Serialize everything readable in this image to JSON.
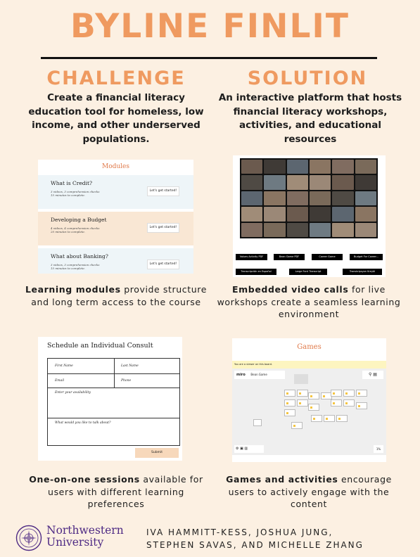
{
  "title": "BYLINE FINLIT",
  "challenge": {
    "heading": "CHALLENGE",
    "text": "Create a financial literacy education tool for homeless, low income, and other underserved populations."
  },
  "solution": {
    "heading": "SOLUTION",
    "text": "An interactive platform that hosts financial literacy workshops, activities, and educational resources"
  },
  "modules_panel": {
    "title": "Modules",
    "items": [
      {
        "name": "What is Credit?",
        "desc1": "3 videos, 3 comprehension checks",
        "desc2": "15 minutes to complete.",
        "button": "Let's get started!",
        "bg": "#eef5f8"
      },
      {
        "name": "Developing a Budget",
        "desc1": "4 videos, 4 comprehension checks",
        "desc2": "20 minutes to complete.",
        "button": "Let's get started!",
        "bg": "#f9e7d4"
      },
      {
        "name": "What about Banking?",
        "desc1": "3 videos, 3 comprehension checks",
        "desc2": "15 minutes to complete.",
        "button": "Let's get started!",
        "bg": "#eef5f8"
      }
    ]
  },
  "video_panel": {
    "buttons": [
      "Values Activity PDF",
      "Bean Game PDF",
      "Career Game",
      "Budget For Career...",
      "Transcripción en Español",
      "Large Font Transcript",
      "Transkripsyon Kreyòl"
    ]
  },
  "consult_panel": {
    "title": "Schedule an Individual Consult",
    "first_name": "First Name",
    "last_name": "Last Name",
    "email": "Email",
    "phone": "Phone",
    "availability": "Enter your availability",
    "talk_about": "What would you like to talk about?",
    "submit": "Submit"
  },
  "games_panel": {
    "title": "Games",
    "bar_text": "You are a viewer on this board.",
    "app_name": "miro",
    "board_name": "Bean Game",
    "zoom": "1%"
  },
  "captions": {
    "modules_bold": "Learning modules",
    "modules_rest": " provide structure and long term access to the course",
    "video_bold": "Embedded video calls",
    "video_rest": " for live workshops create a seamless learning environment",
    "consult_bold": "One-on-one sessions",
    "consult_rest": " available for users with different learning preferences",
    "games_bold": "Games and activities",
    "games_rest": " encourage users to actively engage with the content"
  },
  "footer": {
    "university_line1": "Northwestern",
    "university_line2": "University",
    "authors_line1": "IVA HAMMITT-KESS, JOSHUA JUNG,",
    "authors_line2": "STEPHEN SAVAS, AND MICHELLE ZHANG"
  },
  "colors": {
    "accent": "#ef9a60",
    "background": "#fcf0e2",
    "northwestern_purple": "#4e2a84"
  }
}
